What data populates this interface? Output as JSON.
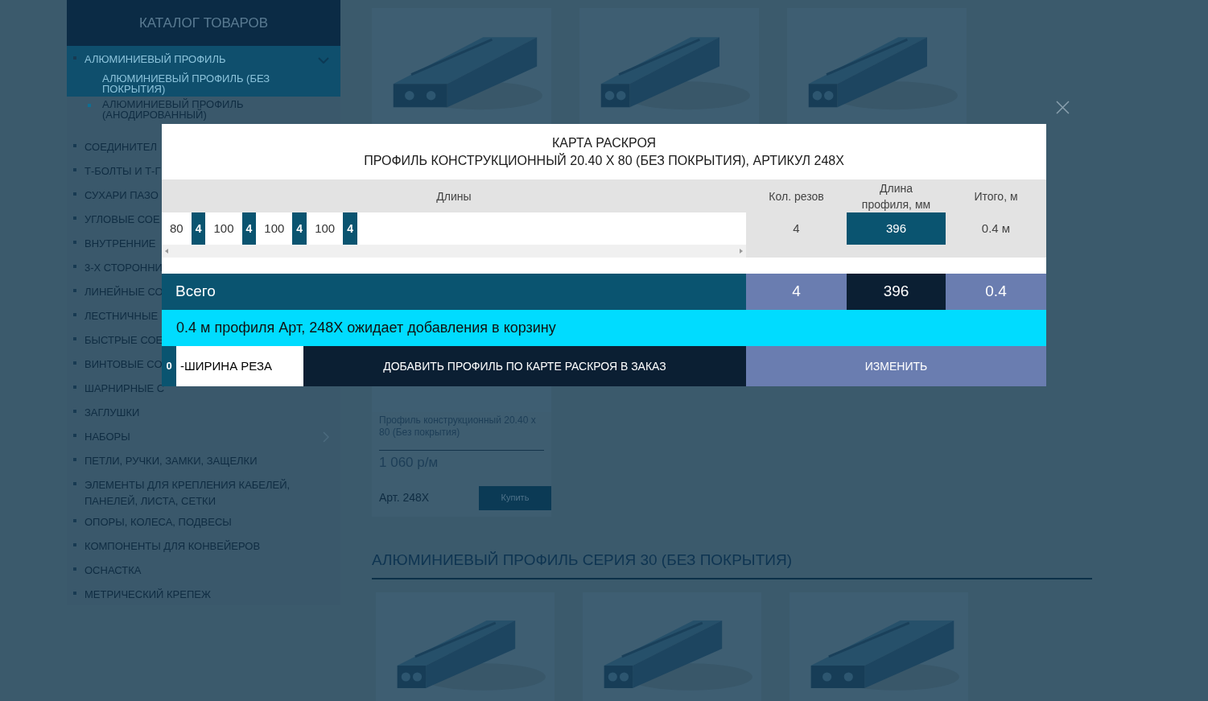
{
  "sidebar": {
    "title": "КАТАЛОГ ТОВАРОВ",
    "items": [
      {
        "label": "АЛЮМИНИЕВЫЙ ПРОФИЛЬ",
        "expanded": true,
        "children": [
          {
            "label": "АЛЮМИНИЕВЫЙ ПРОФИЛЬ (БЕЗ ПОКРЫТИЯ)",
            "selected": true
          },
          {
            "label": "АЛЮМИНИЕВЫЙ ПРОФИЛЬ (АНОДИРОВАННЫЙ)",
            "selected": false
          }
        ]
      },
      {
        "label": "СОЕДИНИТЕЛ"
      },
      {
        "label": "Т-БОЛТЫ И Т-Г"
      },
      {
        "label": "СУХАРИ ПАЗО"
      },
      {
        "label": "УГЛОВЫЕ СОЕ"
      },
      {
        "label": "ВНУТРЕННИЕ"
      },
      {
        "label": "3-Х СТОРОННИ"
      },
      {
        "label": "ЛИНЕЙНЫЕ СО"
      },
      {
        "label": "ЛЕСТНИЧНЫЕ"
      },
      {
        "label": "БЫСТРЫЕ СОЕ"
      },
      {
        "label": "ВИНТОВЫЕ СО"
      },
      {
        "label": "ШАРНИРНЫЕ С"
      },
      {
        "label": "ЗАГЛУШКИ"
      },
      {
        "label": "НАБОРЫ",
        "expanded": false
      },
      {
        "label": "ПЕТЛИ, РУЧКИ, ЗАМКИ, ЗАЩЕЛКИ"
      },
      {
        "label": "ЭЛЕМЕНТЫ ДЛЯ КРЕПЛЕНИЯ КАБЕЛЕЙ, ПАНЕЛЕЙ, ЛИСТА, СЕТКИ"
      },
      {
        "label": "ОПОРЫ, КОЛЕСА, ПОДВЕСЫ"
      },
      {
        "label": "КОМПОНЕНТЫ ДЛЯ КОНВЕЙЕРОВ"
      },
      {
        "label": "ОСНАСТКА"
      },
      {
        "label": "МЕТРИЧЕСКИЙ КРЕПЕЖ"
      }
    ]
  },
  "product": {
    "name": "Профиль конструкционный 20.40 х 80 (Без покрытия)",
    "price": "1 060 р/м",
    "article": "Арт. 248X",
    "buy": "Купить"
  },
  "section_heading": "АЛЮМИНИЕВЫЙ ПРОФИЛЬ СЕРИЯ 30 (БЕЗ ПОКРЫТИЯ)",
  "modal": {
    "title": "КАРТА РАСКРОЯ",
    "subtitle": "ПРОФИЛЬ КОНСТРУКЦИОННЫЙ 20.40 Х 80 (БЕЗ ПОКРЫТИЯ), АРТИКУЛ 248X",
    "columns": [
      "Длины",
      "Кол. резов",
      "Длина профиля, мм",
      "Итого, м"
    ],
    "pieces": [
      {
        "kind": "length",
        "value": "80"
      },
      {
        "kind": "cut",
        "value": "4"
      },
      {
        "kind": "length",
        "value": "100"
      },
      {
        "kind": "cut",
        "value": "4"
      },
      {
        "kind": "length",
        "value": "100"
      },
      {
        "kind": "cut",
        "value": "4"
      },
      {
        "kind": "length",
        "value": "100"
      },
      {
        "kind": "cut",
        "value": "4"
      }
    ],
    "cuts": "4",
    "profile_length": "396",
    "total": "0.4 м",
    "totals": {
      "label": "Всего",
      "cuts": "4",
      "profile_length": "396",
      "total": "0.4"
    },
    "message": "0.4 м профиля Арт, 248X ожидает добавления в корзину",
    "cut_width": {
      "value": "0",
      "label": "-ШИРИНА РЕЗА"
    },
    "add_button": "ДОБАВИТЬ ПРОФИЛЬ ПО КАРТЕ РАСКРОЯ В ЗАКАЗ",
    "change_button": "ИЗМЕНИТЬ"
  }
}
